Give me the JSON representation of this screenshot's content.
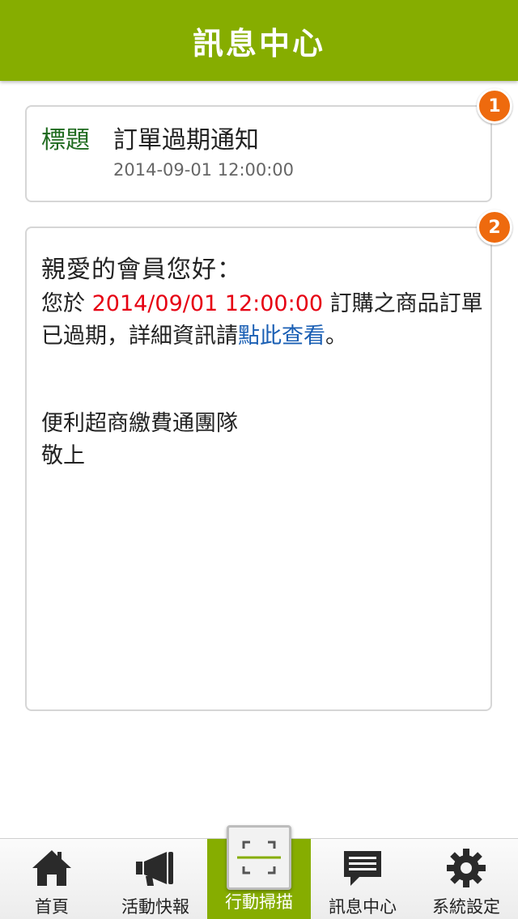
{
  "header": {
    "title": "訊息中心"
  },
  "title_card": {
    "badge": "1",
    "label": "標題",
    "subject": "訂單過期通知",
    "datetime": "2014-09-01 12:00:00"
  },
  "body_card": {
    "badge": "2",
    "greeting": "親愛的會員您好：",
    "line_prefix": "您於 ",
    "highlight_date": "2014/09/01 12:00:00",
    "line_middle": " 訂購之商品訂單已過期，詳細資訊請",
    "link_text": "點此查看",
    "line_suffix": "。",
    "signature_team": "便利超商繳費通團隊",
    "signature_closing": "敬上"
  },
  "nav": {
    "items": [
      {
        "label": "首頁",
        "icon": "home-icon"
      },
      {
        "label": "活動快報",
        "icon": "megaphone-icon"
      },
      {
        "label": "行動掃描",
        "icon": "scan-icon",
        "active": true
      },
      {
        "label": "訊息中心",
        "icon": "message-icon"
      },
      {
        "label": "系統設定",
        "icon": "gear-icon"
      }
    ]
  },
  "colors": {
    "brand_green": "#86ad00",
    "label_green": "#1f6b1f",
    "badge_orange": "#ee6a0e",
    "date_red": "#e60012",
    "link_blue": "#1a5fb4"
  }
}
